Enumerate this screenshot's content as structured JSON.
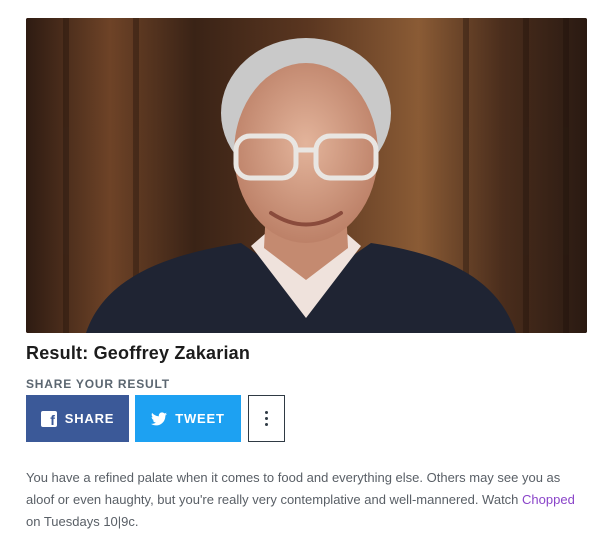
{
  "result": {
    "title": "Result: Geoffrey Zakarian",
    "image_alt": "Geoffrey Zakarian"
  },
  "share": {
    "heading": "SHARE YOUR RESULT",
    "facebook_label": "SHARE",
    "twitter_label": "TWEET",
    "more_icon": "vertical-ellipsis-icon"
  },
  "description": {
    "text_before": "You have a refined palate when it comes to food and everything else. Others may see you as aloof or even haughty, but you're really very contemplative and well-mannered. Watch ",
    "link_text": "Chopped",
    "text_after": " on Tuesdays 10|9c."
  },
  "colors": {
    "facebook": "#3b5998",
    "twitter": "#1da1f2",
    "link": "#8a44c9"
  }
}
